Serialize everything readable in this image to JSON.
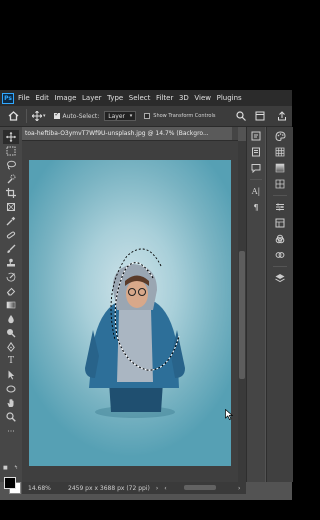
{
  "app": {
    "logo_text": "Ps",
    "menu": [
      "File",
      "Edit",
      "Image",
      "Layer",
      "Type",
      "Select",
      "Filter",
      "3D",
      "View",
      "Plugins"
    ]
  },
  "options_bar": {
    "home_icon": "home-icon",
    "move_icon": "move-icon",
    "auto_select_label": "Auto-Select:",
    "auto_select_checked": true,
    "layer_select_value": "Layer",
    "show_transform_label": "Show Transform Controls",
    "show_transform_checked": false
  },
  "document": {
    "tab_title": "toa-heftiba-O3ymvT7Wf9U-unsplash.jpg @ 14.7% (Backgro...",
    "zoom": "14.68%",
    "dimensions": "2459 px x 3688 px (72 ppi)"
  },
  "colors": {
    "accent": "#31a8ff",
    "canvas_bg_start": "#cfe3e9",
    "canvas_bg_end": "#56a0b4",
    "jacket": "#2d6f99",
    "hood": "#aab6c2"
  },
  "tools": [
    "move-tool",
    "marquee-tool",
    "lasso-tool",
    "quick-selection-tool",
    "crop-tool",
    "frame-tool",
    "eyedropper-tool",
    "spot-healing-tool",
    "brush-tool",
    "clone-stamp-tool",
    "history-brush-tool",
    "eraser-tool",
    "gradient-tool",
    "blur-tool",
    "dodge-tool",
    "pen-tool",
    "type-tool",
    "path-selection-tool",
    "rectangle-tool",
    "hand-tool",
    "zoom-tool"
  ]
}
